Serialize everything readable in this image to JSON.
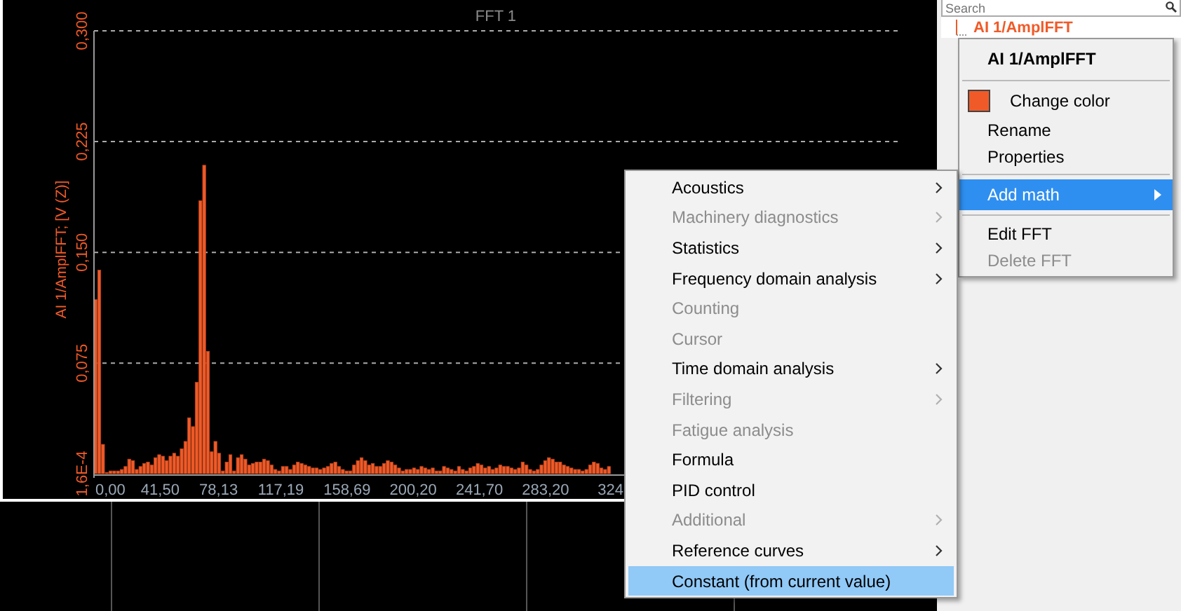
{
  "chart": {
    "chart_data": {
      "type": "bar",
      "title": "FFT 1",
      "ylabel": "AI 1/AmplFFT; [V (Z)]",
      "x": [
        0,
        2.35,
        4.7,
        7.05,
        9.4,
        11.75,
        14.1,
        16.45,
        18.8,
        21.15,
        23.5,
        25.85,
        28.2,
        30.55,
        32.9,
        35.25,
        37.6,
        39.95,
        42.3,
        44.65,
        47,
        49.35,
        51.7,
        54.05,
        56.4,
        58.75,
        61.1,
        63.45,
        65.8,
        68.15,
        70.5,
        72.85,
        75.2,
        77.55,
        79.9,
        82.25,
        84.6,
        86.95,
        89.3,
        91.65,
        94,
        96.35,
        98.7,
        101.05,
        103.4,
        105.75,
        108.1,
        110.45,
        112.8,
        115.15,
        117.5,
        119.85,
        122.2,
        124.55,
        126.9,
        129.25,
        131.6,
        133.95,
        136.3,
        138.65,
        141,
        143.35,
        145.7,
        148.05,
        150.4,
        152.75,
        155.1,
        157.45,
        159.8,
        162.15,
        164.5,
        166.85,
        169.2,
        171.55,
        173.9,
        176.25,
        178.6,
        180.95,
        183.3,
        185.65,
        188,
        190.35,
        192.7,
        195.05,
        197.4,
        199.75,
        202.1,
        204.45,
        206.8,
        209.15,
        211.5,
        213.85,
        216.2,
        218.55,
        220.9,
        223.25,
        225.6,
        227.95,
        230.3,
        232.65,
        235,
        237.35,
        239.7,
        242.05,
        244.4,
        246.75,
        249.1,
        251.45,
        253.8,
        256.15,
        258.5,
        260.85,
        263.2,
        265.55,
        267.9,
        270.25,
        272.6,
        274.95,
        277.3,
        279.65,
        282,
        284.35,
        286.7,
        289.05,
        291.4,
        293.75,
        296.1,
        298.45,
        300.8,
        303.15,
        305.5,
        307.85,
        310.2,
        312.55,
        314.9,
        317.25,
        319.6,
        321.95
      ],
      "series": [
        {
          "color": "#f05a28",
          "values": [
            0.118,
            0.138,
            0.02,
            0.001,
            0.002,
            0.002,
            0.002,
            0.003,
            0.005,
            0.01,
            0.009,
            0.003,
            0.005,
            0.007,
            0.008,
            0.006,
            0.011,
            0.013,
            0.012,
            0.009,
            0.012,
            0.014,
            0.012,
            0.017,
            0.022,
            0.038,
            0.032,
            0.062,
            0.185,
            0.209,
            0.083,
            0.015,
            0.022,
            0.014,
            0.002,
            0.008,
            0.013,
            0.002,
            0.011,
            0.013,
            0.01,
            0.006,
            0.007,
            0.008,
            0.008,
            0.01,
            0.009,
            0.006,
            0.003,
            0.002,
            0.005,
            0.005,
            0.003,
            0.006,
            0.008,
            0.007,
            0.006,
            0.005,
            0.004,
            0.004,
            0.003,
            0.004,
            0.005,
            0.007,
            0.008,
            0.005,
            0.003,
            0.002,
            0.002,
            0.006,
            0.009,
            0.011,
            0.009,
            0.006,
            0.007,
            0.005,
            0.005,
            0.007,
            0.009,
            0.008,
            0.006,
            0.004,
            0.002,
            0.003,
            0.003,
            0.004,
            0.003,
            0.005,
            0.004,
            0.003,
            0.004,
            0.002,
            0.002,
            0.005,
            0.004,
            0.003,
            0.002,
            0.005,
            0.003,
            0.002,
            0.004,
            0.005,
            0.007,
            0.006,
            0.004,
            0.005,
            0.003,
            0.004,
            0.006,
            0.005,
            0.005,
            0.004,
            0.003,
            0.004,
            0.008,
            0.006,
            0.003,
            0.002,
            0.003,
            0.006,
            0.009,
            0.011,
            0.01,
            0.008,
            0.008,
            0.006,
            0.005,
            0.004,
            0.003,
            0.003,
            0.002,
            0.003,
            0.006,
            0.008,
            0.007,
            0.004,
            0.003,
            0.005
          ]
        }
      ],
      "xlim": [
        0,
        504
      ],
      "grid": true,
      "ylim": [
        0.00016,
        0.3
      ],
      "xticks": [
        {
          "value": 0,
          "label": "0,00"
        },
        {
          "value": 41.5,
          "label": "41,50"
        },
        {
          "value": 78.13,
          "label": "78,13"
        },
        {
          "value": 117.19,
          "label": "117,19"
        },
        {
          "value": 158.69,
          "label": "158,69"
        },
        {
          "value": 200.2,
          "label": "200,20"
        },
        {
          "value": 241.7,
          "label": "241,70"
        },
        {
          "value": 283.2,
          "label": "283,20"
        },
        {
          "value": 324,
          "label": "324"
        }
      ],
      "yticks": [
        {
          "value": 0.00016,
          "label": "1,6E-4"
        },
        {
          "value": 0.075,
          "label": "0,075"
        },
        {
          "value": 0.15,
          "label": "0,150"
        },
        {
          "value": 0.225,
          "label": "0,225"
        },
        {
          "value": 0.3,
          "label": "0,300"
        }
      ]
    }
  },
  "panel": {
    "search": {
      "placeholder": "Search"
    },
    "channels": [
      {
        "name": "AI 1/AmplFFT"
      }
    ]
  },
  "context_menu": {
    "title": "AI 1/AmplFFT",
    "items": [
      {
        "kind": "separator"
      },
      {
        "kind": "color",
        "label": "Change color",
        "color": "#f05a28",
        "selected": false,
        "disabled": false,
        "submenu": false
      },
      {
        "kind": "item",
        "label": "Rename",
        "selected": false,
        "disabled": false,
        "submenu": false
      },
      {
        "kind": "item",
        "label": "Properties",
        "selected": false,
        "disabled": false,
        "submenu": false
      },
      {
        "kind": "separator"
      },
      {
        "kind": "item",
        "label": "Add math",
        "selected": true,
        "disabled": false,
        "submenu": true
      },
      {
        "kind": "separator"
      },
      {
        "kind": "item",
        "label": "Edit FFT",
        "selected": false,
        "disabled": false,
        "submenu": false
      },
      {
        "kind": "item",
        "label": "Delete FFT",
        "selected": false,
        "disabled": true,
        "submenu": false
      }
    ]
  },
  "submenu": {
    "items": [
      {
        "label": "Acoustics",
        "selected": false,
        "disabled": false,
        "submenu": true
      },
      {
        "label": "Machinery diagnostics",
        "selected": false,
        "disabled": true,
        "submenu": true
      },
      {
        "label": "Statistics",
        "selected": false,
        "disabled": false,
        "submenu": true
      },
      {
        "label": "Frequency domain analysis",
        "selected": false,
        "disabled": false,
        "submenu": true
      },
      {
        "label": "Counting",
        "selected": false,
        "disabled": true,
        "submenu": false
      },
      {
        "label": "Cursor",
        "selected": false,
        "disabled": true,
        "submenu": false
      },
      {
        "label": "Time domain analysis",
        "selected": false,
        "disabled": false,
        "submenu": true
      },
      {
        "label": "Filtering",
        "selected": false,
        "disabled": true,
        "submenu": true
      },
      {
        "label": "Fatigue analysis",
        "selected": false,
        "disabled": true,
        "submenu": false
      },
      {
        "label": "Formula",
        "selected": false,
        "disabled": false,
        "submenu": false
      },
      {
        "label": "PID control",
        "selected": false,
        "disabled": false,
        "submenu": false
      },
      {
        "label": "Additional",
        "selected": false,
        "disabled": true,
        "submenu": true
      },
      {
        "label": "Reference curves",
        "selected": false,
        "disabled": false,
        "submenu": true
      },
      {
        "label": "Constant (from current value)",
        "selected": true,
        "disabled": false,
        "submenu": false
      }
    ]
  }
}
